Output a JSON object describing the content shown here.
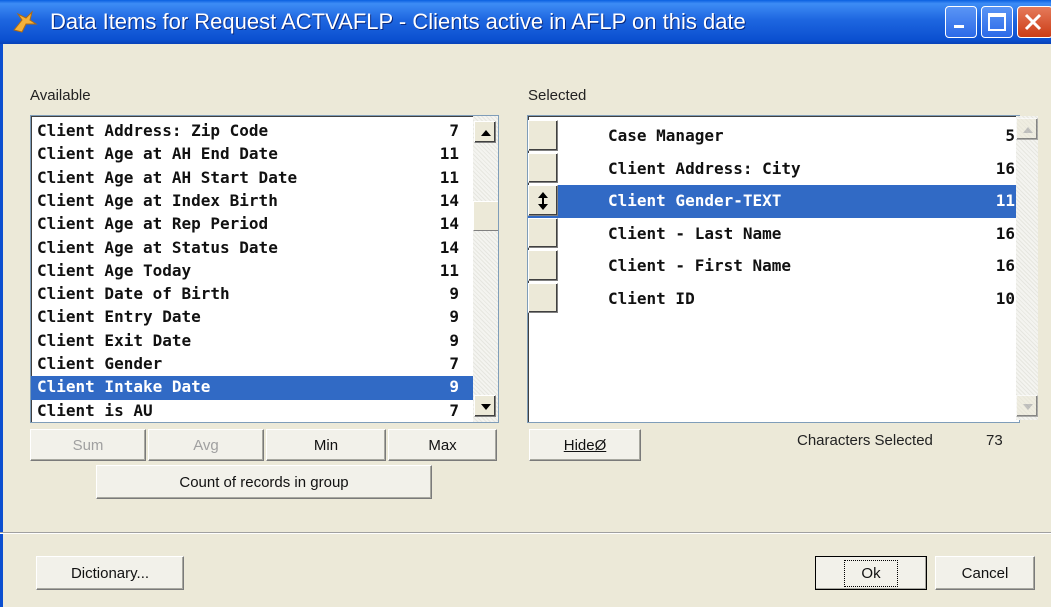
{
  "window": {
    "title": "Data Items for Request ACTVAFLP - Clients active in AFLP on this date",
    "icon": "app-icon"
  },
  "available": {
    "label": "Available",
    "items": [
      {
        "name": "Client Address: Zip Code",
        "len": "7"
      },
      {
        "name": "Client Age at AH End Date",
        "len": "11"
      },
      {
        "name": "Client Age at AH Start Date",
        "len": "11"
      },
      {
        "name": "Client Age at Index Birth",
        "len": "14"
      },
      {
        "name": "Client Age at Rep Period",
        "len": "14"
      },
      {
        "name": "Client Age at Status Date",
        "len": "14"
      },
      {
        "name": "Client Age Today",
        "len": "11"
      },
      {
        "name": "Client Date of Birth",
        "len": "9"
      },
      {
        "name": "Client Entry Date",
        "len": "9"
      },
      {
        "name": "Client Exit Date",
        "len": "9"
      },
      {
        "name": "Client Gender",
        "len": "7"
      },
      {
        "name": "Client Intake Date",
        "len": "9",
        "selected": true
      },
      {
        "name": "Client is AU",
        "len": "7"
      }
    ]
  },
  "selected": {
    "label": "Selected",
    "items": [
      {
        "name": "Case Manager",
        "len": "5"
      },
      {
        "name": "Client Address: City",
        "len": "16"
      },
      {
        "name": "Client Gender-TEXT",
        "len": "11",
        "selected": true
      },
      {
        "name": "Client - Last Name",
        "len": "16"
      },
      {
        "name": "Client - First Name",
        "len": "16"
      },
      {
        "name": "Client ID",
        "len": "10"
      }
    ]
  },
  "buttons": {
    "sum": "Sum",
    "avg": "Avg",
    "min": "Min",
    "max": "Max",
    "count": "Count of records in group",
    "hide": "HideØ",
    "dictionary": "Dictionary...",
    "ok": "Ok",
    "cancel": "Cancel"
  },
  "chars_selected": {
    "label": "Characters Selected",
    "value": "73"
  }
}
